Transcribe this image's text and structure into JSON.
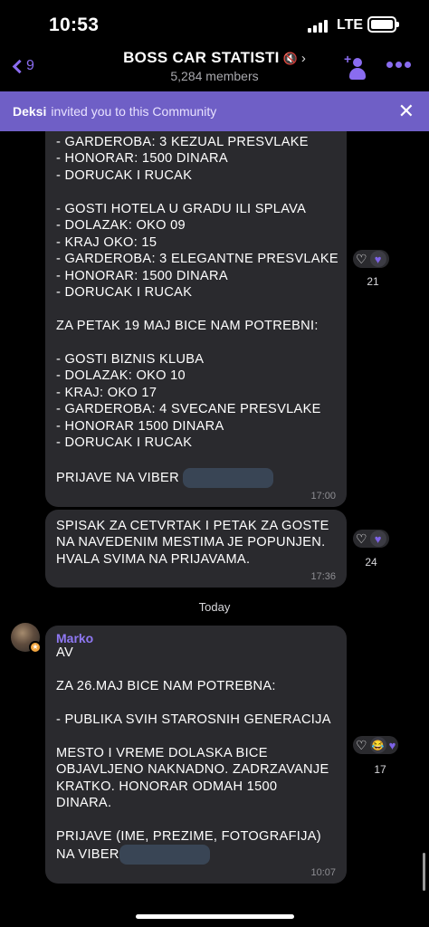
{
  "status_bar": {
    "time": "10:53",
    "network": "LTE"
  },
  "header": {
    "back_count": "9",
    "title": "BOSS CAR STATISTI",
    "subtitle": "5,284 members",
    "icons": [
      "back-chevron-icon",
      "mute-icon",
      "chevron-right-icon",
      "add-member-icon",
      "more-icon"
    ],
    "accent_color": "#8a6cf0"
  },
  "banner": {
    "name": "Deksi",
    "text": "invited you to this Community",
    "close_icon": "close-icon",
    "background": "#6f5fc6"
  },
  "messages": [
    {
      "text": "- GARDEROBA: 3 KEZUAL PRESVLAKE\n- HONORAR: 1500 DINARA\n- DORUCAK I RUCAK\n\n- GOSTI HOTELA U GRADU ILI SPLAVA\n- DOLAZAK: OKO 09\n- KRAJ OKO: 15\n- GARDEROBA: 3 ELEGANTNE PRESVLAKE\n- HONORAR: 1500 DINARA\n- DORUCAK I RUCAK\n\nZA PETAK 19 MAJ BICE NAM POTREBNI:\n\n- GOSTI BIZNIS KLUBA\n- DOLAZAK: OKO 10\n- KRAJ: OKO 17\n- GARDEROBA: 4 SVECANE PRESVLAKE\n- HONORAR 1500 DINARA\n- DORUCAK I RUCAK",
      "last_line": "PRIJAVE NA VIBER",
      "time": "17:00",
      "reaction_count": "21"
    },
    {
      "text": "SPISAK ZA CETVRTAK I PETAK ZA GOSTE\nNA NAVEDENIM MESTIMA JE POPUNJEN.\nHVALA SVIMA NA PRIJAVAMA.",
      "time": "17:36",
      "reaction_count": "24"
    },
    {
      "sender": "Marko",
      "text": "AV\n\nZA 26.MAJ BICE NAM POTREBNA:\n\n- PUBLIKA SVIH STAROSNIH GENERACIJA\n\nMESTO I VREME DOLASKA BICE\nOBJAVLJENO NAKNADNO. ZADRZAVANJE\nKRATKO. HONORAR ODMAH 1500\nDINARA.\n\nPRIJAVE (IME, PREZIME, FOTOGRAFIJA)",
      "last_line": "NA VIBER",
      "time": "10:07",
      "reaction_count": "17"
    }
  ],
  "date_separator": "Today"
}
